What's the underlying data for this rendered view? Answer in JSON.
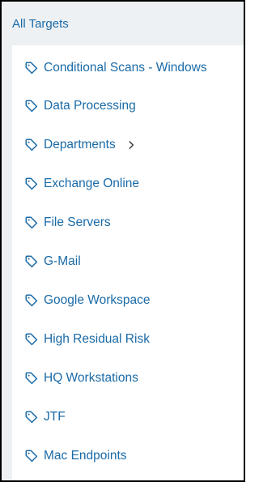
{
  "header": {
    "title": "All Targets"
  },
  "colors": {
    "link": "#1a6aa7",
    "header_bg": "#eef1f3",
    "list_bg": "#ffffff",
    "border": "#000000"
  },
  "items": [
    {
      "label": "Conditional Scans - Windows",
      "icon": "tag-icon",
      "has_children": false
    },
    {
      "label": "Data Processing",
      "icon": "tag-icon",
      "has_children": false
    },
    {
      "label": "Departments",
      "icon": "tag-icon",
      "has_children": true,
      "expand_icon": "chevron-right-icon"
    },
    {
      "label": "Exchange Online",
      "icon": "tag-icon",
      "has_children": false
    },
    {
      "label": "File Servers",
      "icon": "tag-icon",
      "has_children": false
    },
    {
      "label": "G-Mail",
      "icon": "tag-icon",
      "has_children": false
    },
    {
      "label": "Google Workspace",
      "icon": "tag-icon",
      "has_children": false
    },
    {
      "label": "High Residual Risk",
      "icon": "tag-icon",
      "has_children": false
    },
    {
      "label": "HQ Workstations",
      "icon": "tag-icon",
      "has_children": false
    },
    {
      "label": "JTF",
      "icon": "tag-icon",
      "has_children": false
    },
    {
      "label": "Mac Endpoints",
      "icon": "tag-icon",
      "has_children": false
    }
  ]
}
